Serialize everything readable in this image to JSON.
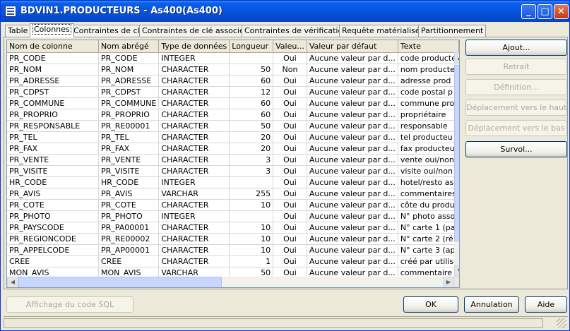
{
  "window": {
    "title": "BDVIN1.PRODUCTEURS - As400(As400)"
  },
  "tabs": [
    "Table",
    "Colonnes",
    "Contraintes de clé",
    "Contraintes de clé associée",
    "Contraintes de vérification",
    "Requête matérialisée",
    "Partitionnement"
  ],
  "active_tab": "Colonnes",
  "grid": {
    "columns": [
      "Nom de colonne",
      "Nom abrégé",
      "Type de données",
      "Longueur",
      "Valeu...",
      "Valeur par défaut",
      "Texte"
    ],
    "rows": [
      [
        "PR_CODE",
        "PR_CODE",
        "INTEGER",
        "",
        "Oui",
        "Aucune valeur par d...",
        "code producte"
      ],
      [
        "PR_NOM",
        "PR_NOM",
        "CHARACTER",
        "50",
        "Non",
        "Aucune valeur par d...",
        "nom producte"
      ],
      [
        "PR_ADRESSE",
        "PR_ADRESSE",
        "CHARACTER",
        "60",
        "Oui",
        "Aucune valeur par d...",
        "adresse prod"
      ],
      [
        "PR_CDPST",
        "PR_CDPST",
        "CHARACTER",
        "12",
        "Oui",
        "Aucune valeur par d...",
        "code postal p"
      ],
      [
        "PR_COMMUNE",
        "PR_COMMUNE",
        "CHARACTER",
        "60",
        "Oui",
        "Aucune valeur par d...",
        "commune pro"
      ],
      [
        "PR_PROPRIO",
        "PR_PROPRIO",
        "CHARACTER",
        "60",
        "Oui",
        "Aucune valeur par d...",
        "propriétaire"
      ],
      [
        "PR_RESPONSABLE",
        "PR_RE00001",
        "CHARACTER",
        "50",
        "Oui",
        "Aucune valeur par d...",
        "responsable"
      ],
      [
        "PR_TEL",
        "PR_TEL",
        "CHARACTER",
        "20",
        "Oui",
        "Aucune valeur par d...",
        "tel producteu"
      ],
      [
        "PR_FAX",
        "PR_FAX",
        "CHARACTER",
        "20",
        "Oui",
        "Aucune valeur par d...",
        "fax producteu"
      ],
      [
        "PR_VENTE",
        "PR_VENTE",
        "CHARACTER",
        "3",
        "Oui",
        "Aucune valeur par d...",
        "vente oui/non"
      ],
      [
        "PR_VISITE",
        "PR_VISITE",
        "CHARACTER",
        "3",
        "Oui",
        "Aucune valeur par d...",
        "visite oui/non"
      ],
      [
        "HR_CODE",
        "HR_CODE",
        "INTEGER",
        "",
        "Oui",
        "Aucune valeur par d...",
        "hotel/resto as"
      ],
      [
        "PR_AVIS",
        "PR_AVIS",
        "VARCHAR",
        "255",
        "Oui",
        "Aucune valeur par d...",
        "commentaires"
      ],
      [
        "PR_COTE",
        "PR_COTE",
        "CHARACTER",
        "10",
        "Oui",
        "Aucune valeur par d...",
        "côte du produ"
      ],
      [
        "PR_PHOTO",
        "PR_PHOTO",
        "INTEGER",
        "",
        "Oui",
        "Aucune valeur par d...",
        "N° photo asso"
      ],
      [
        "PR_PAYSCODE",
        "PR_PA00001",
        "CHARACTER",
        "10",
        "Oui",
        "Aucune valeur par d...",
        "N° carte 1 (pa"
      ],
      [
        "PR_REGIONCODE",
        "PR_RE00002",
        "CHARACTER",
        "10",
        "Oui",
        "Aucune valeur par d...",
        "N° carte 2 (ré"
      ],
      [
        "PR_APPELCODE",
        "PR_AP00001",
        "CHARACTER",
        "10",
        "Oui",
        "Aucune valeur par d...",
        "N° carte 3 (ap"
      ],
      [
        "CREE",
        "CREE",
        "CHARACTER",
        "1",
        "Oui",
        "Aucune valeur par d...",
        "créé par utilis"
      ],
      [
        "MON_AVIS",
        "MON_AVIS",
        "VARCHAR",
        "50",
        "Oui",
        "Aucune valeur par d...",
        "commentaire"
      ]
    ]
  },
  "right_buttons": [
    {
      "label": "Ajout...",
      "enabled": true
    },
    {
      "label": "Retrait",
      "enabled": false
    },
    {
      "label": "Définition...",
      "enabled": false
    },
    {
      "label": "Déplacement vers le haut",
      "enabled": false
    },
    {
      "label": "Déplacement vers le bas",
      "enabled": false
    },
    {
      "label": "Survol...",
      "enabled": true
    }
  ],
  "bottom_buttons": {
    "sql": "Affichage du code SQL",
    "ok": "OK",
    "cancel": "Annulation",
    "help": "Aide"
  },
  "title_buttons": {
    "minimize": "_",
    "maximize": "□",
    "close": "✕"
  }
}
